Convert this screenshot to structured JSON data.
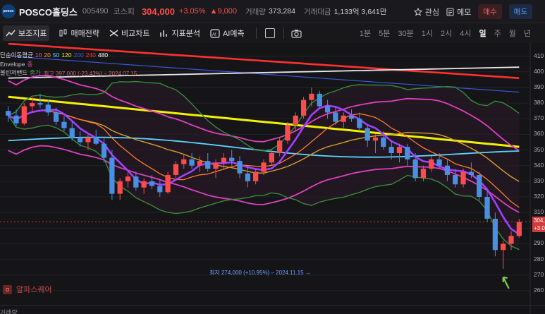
{
  "header": {
    "logo_text": "posco",
    "name": "POSCO홀딩스",
    "code": "005490",
    "market": "코스피",
    "price": "304,000",
    "change_pct": "+3.05%",
    "change_amt": "▲9,000",
    "volume_label": "거래량",
    "volume": "373,284",
    "amount_label": "거래대금",
    "amount": "1,133억 3,641만",
    "watch": "관심",
    "memo": "메모",
    "buy": "매수",
    "sell": "매도"
  },
  "toolbar": {
    "indicator": "보조지표",
    "strategy": "매매전략",
    "compare": "비교차트",
    "analysis": "지표분석",
    "ai": "AI예측",
    "periods": [
      "1분",
      "5분",
      "30분",
      "1시",
      "2시",
      "4시",
      "일",
      "주",
      "월",
      "년"
    ],
    "active_period": "일"
  },
  "legend": {
    "ma_label": "단순이동평균",
    "ma_periods": [
      "10",
      "20",
      "50",
      "120",
      "200",
      "240",
      "480"
    ],
    "envelope": "Envelope",
    "envelope_param": "종",
    "bollinger": "볼린저밴드",
    "bollinger_param": "종가"
  },
  "annotations": {
    "high": "최고 397,000 (-23.43%) – 2024.07.15",
    "low": "최저 274,000 (+10.95%) – 2024.11.15 →"
  },
  "price_axis": [
    "410",
    "400",
    "390",
    "380",
    "370",
    "360",
    "350",
    "340",
    "330",
    "320",
    "310",
    "300",
    "290",
    "280",
    "270",
    "260"
  ],
  "current_price_tag": [
    "304,",
    "+3.0"
  ],
  "brand": "알파스퀘어",
  "volume_pane_label": "거래량",
  "colors": {
    "up": "#ff4b4b",
    "down": "#4a90e2",
    "buy_bg": "#3a1f22",
    "sell_bg": "#1c2a42"
  },
  "chart_data": {
    "type": "candlestick",
    "ylim": [
      255,
      413
    ],
    "candles": [
      [
        375,
        378,
        368,
        372
      ],
      [
        372,
        376,
        365,
        367
      ],
      [
        367,
        380,
        366,
        378
      ],
      [
        378,
        384,
        374,
        380
      ],
      [
        380,
        386,
        377,
        379
      ],
      [
        379,
        382,
        372,
        374
      ],
      [
        374,
        377,
        366,
        368
      ],
      [
        368,
        372,
        362,
        364
      ],
      [
        364,
        368,
        356,
        358
      ],
      [
        358,
        362,
        352,
        355
      ],
      [
        355,
        360,
        350,
        358
      ],
      [
        358,
        363,
        353,
        354
      ],
      [
        354,
        358,
        342,
        345
      ],
      [
        345,
        350,
        318,
        322
      ],
      [
        322,
        332,
        318,
        330
      ],
      [
        330,
        336,
        326,
        333
      ],
      [
        333,
        336,
        324,
        326
      ],
      [
        326,
        332,
        322,
        330
      ],
      [
        330,
        334,
        325,
        327
      ],
      [
        327,
        331,
        320,
        323
      ],
      [
        323,
        336,
        322,
        334
      ],
      [
        334,
        343,
        332,
        341
      ],
      [
        341,
        347,
        338,
        344
      ],
      [
        344,
        348,
        338,
        340
      ],
      [
        340,
        346,
        336,
        343
      ],
      [
        343,
        348,
        336,
        338
      ],
      [
        338,
        344,
        332,
        342
      ],
      [
        342,
        348,
        338,
        345
      ],
      [
        345,
        350,
        340,
        343
      ],
      [
        343,
        346,
        332,
        335
      ],
      [
        335,
        340,
        326,
        330
      ],
      [
        330,
        338,
        328,
        336
      ],
      [
        336,
        344,
        334,
        342
      ],
      [
        342,
        350,
        340,
        348
      ],
      [
        348,
        358,
        346,
        356
      ],
      [
        356,
        368,
        354,
        366
      ],
      [
        366,
        374,
        362,
        372
      ],
      [
        372,
        384,
        370,
        382
      ],
      [
        382,
        390,
        378,
        386
      ],
      [
        386,
        388,
        376,
        378
      ],
      [
        378,
        382,
        370,
        374
      ],
      [
        374,
        378,
        366,
        368
      ],
      [
        368,
        374,
        364,
        372
      ],
      [
        372,
        376,
        368,
        370
      ],
      [
        370,
        374,
        362,
        364
      ],
      [
        364,
        366,
        352,
        356
      ],
      [
        356,
        360,
        348,
        358
      ],
      [
        358,
        362,
        350,
        352
      ],
      [
        352,
        356,
        344,
        348
      ],
      [
        348,
        354,
        342,
        352
      ],
      [
        352,
        354,
        340,
        344
      ],
      [
        344,
        348,
        330,
        332
      ],
      [
        332,
        340,
        330,
        338
      ],
      [
        338,
        346,
        336,
        344
      ],
      [
        344,
        348,
        338,
        340
      ],
      [
        340,
        344,
        330,
        334
      ],
      [
        334,
        338,
        326,
        328
      ],
      [
        328,
        338,
        326,
        336
      ],
      [
        336,
        342,
        332,
        334
      ],
      [
        334,
        336,
        318,
        320
      ],
      [
        320,
        324,
        304,
        306
      ],
      [
        306,
        310,
        282,
        286
      ],
      [
        286,
        292,
        274,
        290
      ],
      [
        290,
        298,
        286,
        295
      ],
      [
        295,
        306,
        294,
        304
      ]
    ]
  }
}
